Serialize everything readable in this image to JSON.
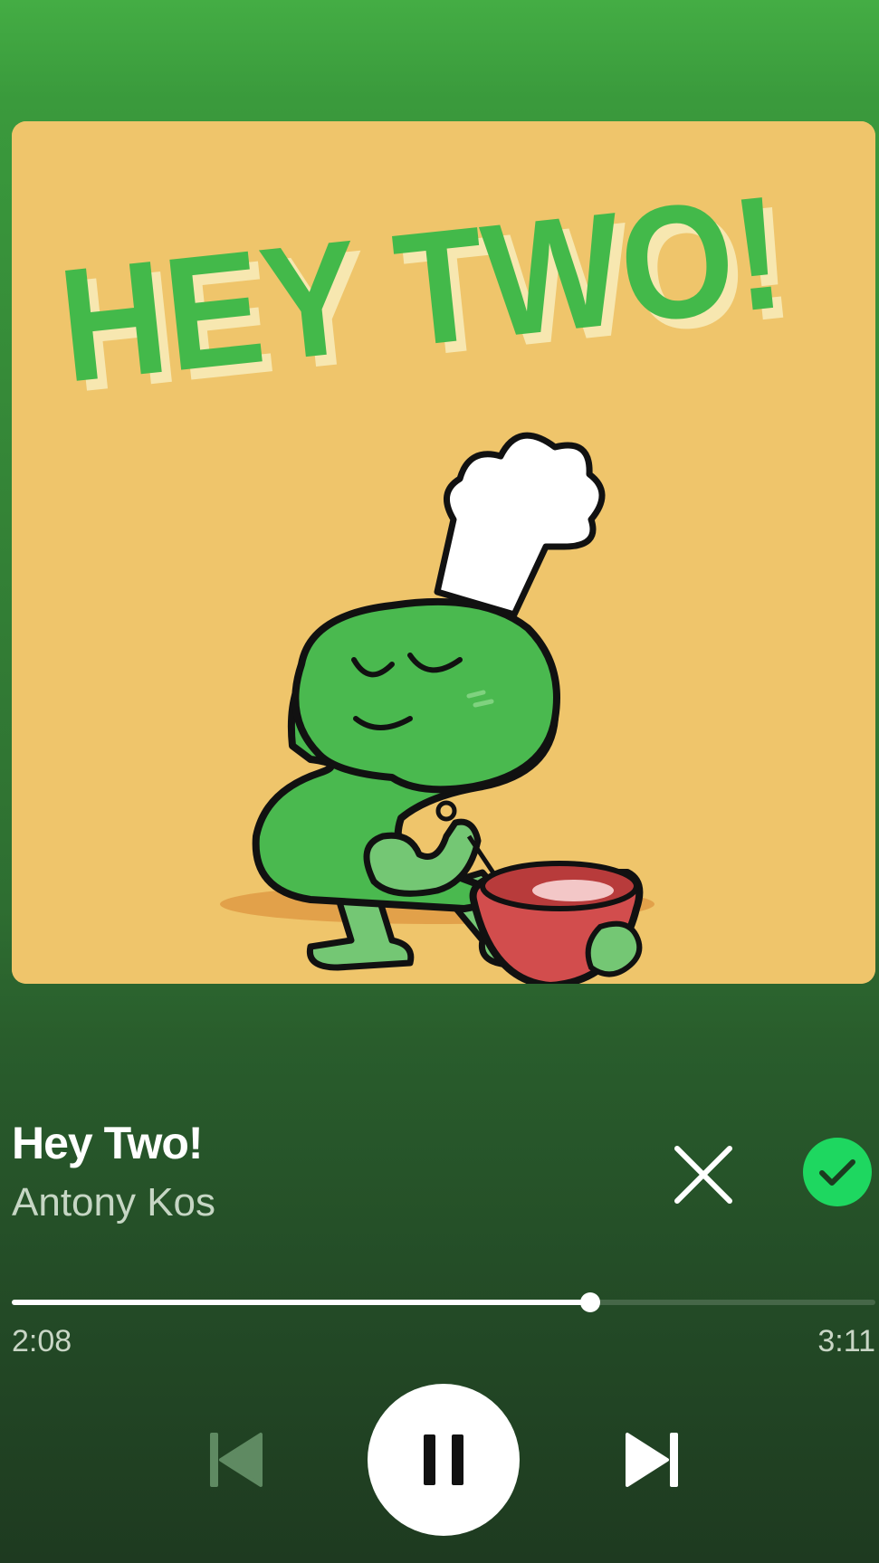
{
  "track": {
    "title": "Hey Two!",
    "artist": "Antony Kos",
    "artwork": {
      "text": "HEY TWO!",
      "description": "green number two character in chef hat whisking a red bowl",
      "background_color": "#efc56b",
      "text_color": "#43b94a"
    }
  },
  "playback": {
    "elapsed": "2:08",
    "duration": "3:11",
    "progress_fraction": 0.67,
    "state": "playing"
  },
  "actions": {
    "remove_icon": "close-icon",
    "add_icon": "check-circle-icon",
    "add_color": "#1ed760"
  },
  "controls": {
    "previous_icon": "skip-previous-icon",
    "pause_icon": "pause-icon",
    "next_icon": "skip-next-icon"
  }
}
